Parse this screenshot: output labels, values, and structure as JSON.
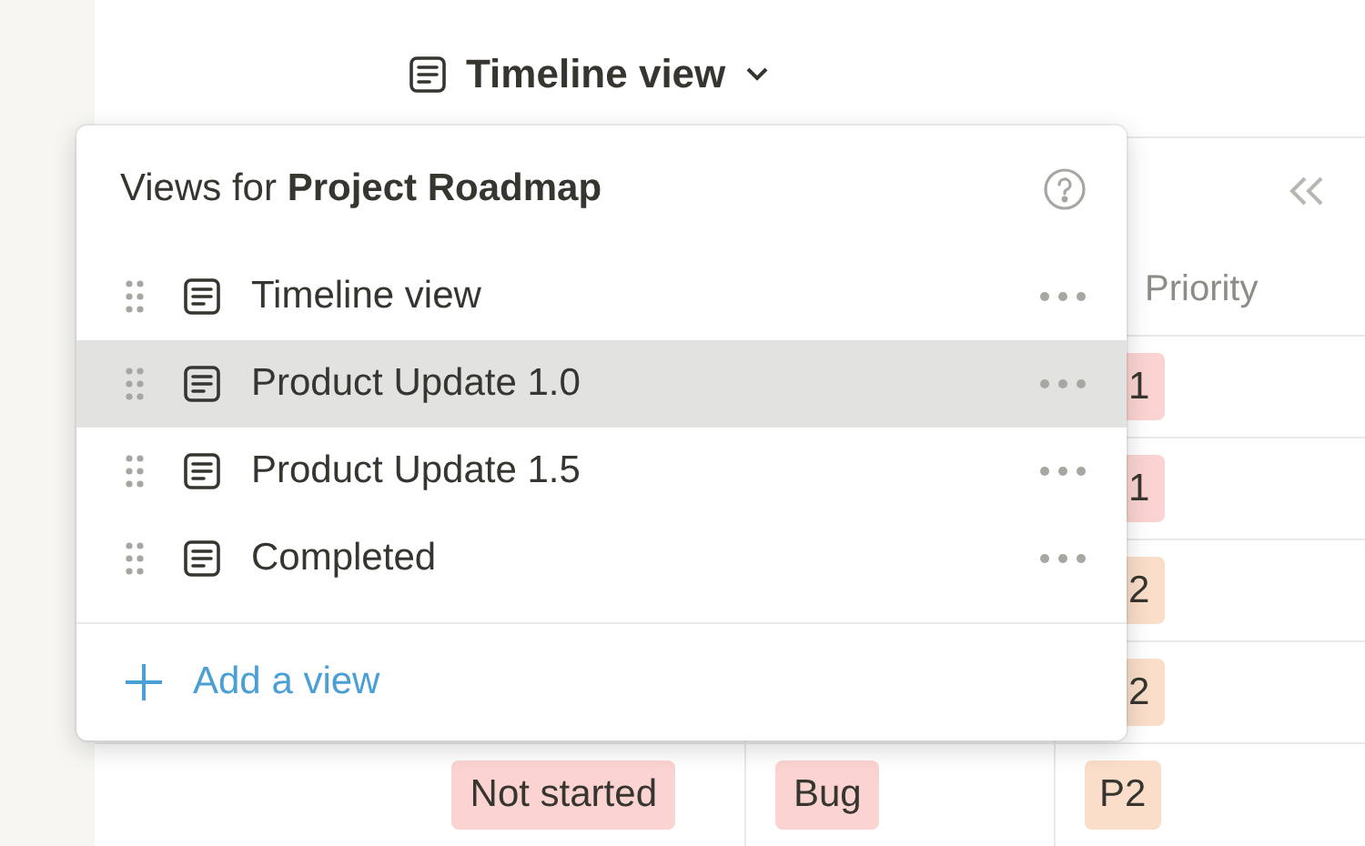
{
  "header": {
    "title": "Timeline view"
  },
  "table": {
    "columns": [
      {
        "label": "Priority"
      }
    ],
    "rows": [
      {
        "priority": "1",
        "color": "#fbd4d2"
      },
      {
        "priority": "1",
        "color": "#fbd4d2"
      },
      {
        "priority": "2",
        "color": "#fadec9"
      },
      {
        "priority": "2",
        "color": "#fadec9"
      },
      {
        "status": "Not started",
        "type": "Bug",
        "priority": "P2",
        "color": "#fadec9"
      }
    ]
  },
  "popup": {
    "title_prefix": "Views for",
    "title_bold": "Project Roadmap",
    "views": [
      {
        "label": "Timeline view",
        "selected": false
      },
      {
        "label": "Product Update 1.0",
        "selected": true
      },
      {
        "label": "Product Update 1.5",
        "selected": false
      },
      {
        "label": "Completed",
        "selected": false
      }
    ],
    "add_label": "Add a view"
  }
}
